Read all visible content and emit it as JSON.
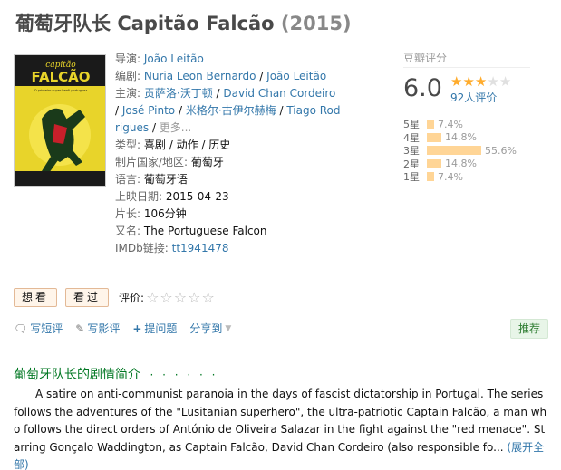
{
  "title": {
    "chinese": "葡萄牙队长",
    "original": "Capitão Falcão",
    "year": "(2015)"
  },
  "poster": {
    "title_line1": "capitão",
    "title_line2": "FALCÃO",
    "tagline": "O primeiro super-herói portuguez",
    "colors": {
      "background": "#e8d42a",
      "dark": "#1a3a1a",
      "red": "#c8202a"
    }
  },
  "info": {
    "director_label": "导演:",
    "director": "João Leitão",
    "writer_label": "编剧:",
    "writers": [
      "Nuria Leon Bernardo",
      "João Leitão"
    ],
    "cast_label": "主演:",
    "cast": [
      "贡萨洛·沃丁顿",
      "David Chan Cordeiro",
      "José Pinto",
      "米格尔·古伊尔赫梅",
      "Tiago Rodrigues"
    ],
    "cast_more": "更多...",
    "genre_label": "类型:",
    "genres": [
      "喜剧",
      "动作",
      "历史"
    ],
    "country_label": "制片国家/地区:",
    "country": "葡萄牙",
    "language_label": "语言:",
    "language": "葡萄牙语",
    "release_label": "上映日期:",
    "release": "2015-04-23",
    "runtime_label": "片长:",
    "runtime": "106分钟",
    "aka_label": "又名:",
    "aka": "The Portuguese Falcon",
    "imdb_label": "IMDb链接:",
    "imdb": "tt1941478"
  },
  "rating": {
    "header": "豆瓣评分",
    "score": "6.0",
    "stars_filled": 3,
    "stars_total": 5,
    "votes": "92人评价",
    "distribution": [
      {
        "label": "5星",
        "percent": 7.4,
        "text": "7.4%"
      },
      {
        "label": "4星",
        "percent": 14.8,
        "text": "14.8%"
      },
      {
        "label": "3星",
        "percent": 55.6,
        "text": "55.6%"
      },
      {
        "label": "2星",
        "percent": 14.8,
        "text": "14.8%"
      },
      {
        "label": "1星",
        "percent": 7.4,
        "text": "7.4%"
      }
    ],
    "colors": {
      "star": "#ffac2d",
      "bar": "#ffd596"
    }
  },
  "buttons": {
    "want": "想看",
    "seen": "看过",
    "rate_label": "评价:",
    "empty_stars": "☆☆☆☆☆"
  },
  "actions": {
    "short_review": "写短评",
    "review": "写影评",
    "question": "提问题",
    "share": "分享到",
    "recommend": "推荐"
  },
  "summary": {
    "heading": "葡萄牙队长的剧情简介",
    "dots": "· · · · · ·",
    "text": "A satire on anti-communist paranoia in the days of fascist dictatorship in Portugal. The series follows the adventures of the \"Lusitanian superhero\", the ultra-patriotic Captain Falcão, a man who follows the direct orders of António de Oliveira Salazar in the fight against the \"red menace\". Starring Gonçalo Waddington, as Captain Falcão, David Chan Cordeiro (also responsible fo...",
    "expand": "(展开全部)"
  }
}
